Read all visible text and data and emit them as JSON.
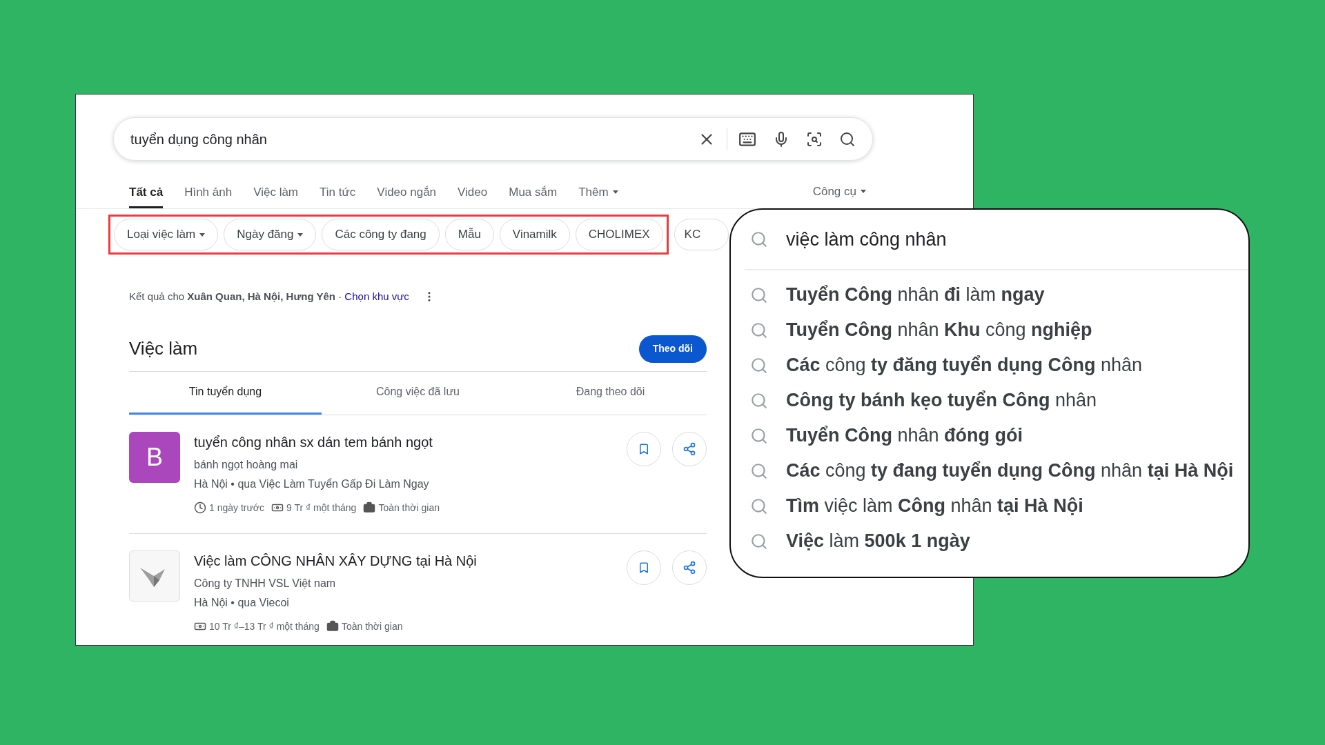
{
  "search": {
    "value": "tuyển dụng công nhân"
  },
  "tabs": [
    {
      "label": "Tất cả",
      "selected": true
    },
    {
      "label": "Hình ảnh",
      "selected": false
    },
    {
      "label": "Việc làm",
      "selected": false
    },
    {
      "label": "Tin tức",
      "selected": false
    },
    {
      "label": "Video ngắn",
      "selected": false
    },
    {
      "label": "Video",
      "selected": false
    },
    {
      "label": "Mua sắm",
      "selected": false
    },
    {
      "label": "Thêm",
      "selected": false,
      "dropdown": true
    }
  ],
  "tools": {
    "label": "Công cụ"
  },
  "highlighted_chips": [
    {
      "label": "Loại việc làm",
      "dropdown": true
    },
    {
      "label": "Ngày đăng",
      "dropdown": true
    },
    {
      "label": "Các công ty đang",
      "dropdown": false
    },
    {
      "label": "Mẫu",
      "dropdown": false
    },
    {
      "label": "Vinamilk",
      "dropdown": false
    },
    {
      "label": "CHOLIMEX",
      "dropdown": false
    }
  ],
  "chips": [
    {
      "label": "KC",
      "dropdown": false
    }
  ],
  "location": {
    "text": "Kết quả cho **Xuân Quan, Hà Nội, Hưng Yên** · ",
    "link": "Chọn khu vực"
  },
  "jobs": {
    "title": "Việc làm",
    "follow": "Theo dõi",
    "tabs": [
      {
        "label": "Tin tuyển dụng",
        "selected": true
      },
      {
        "label": "Công việc đã lưu",
        "selected": false
      },
      {
        "label": "Đang theo dõi",
        "selected": false
      }
    ],
    "items": [
      {
        "logo": {
          "kind": "letter",
          "text": "B",
          "color": "#ab47bc"
        },
        "title": "tuyển công nhân sx dán tem bánh ngọt",
        "company": "bánh ngọt hoàng mai",
        "source": "Hà Nội • qua Việc Làm Tuyển Gấp Đi Làm Ngay",
        "meta": [
          {
            "kind": "time",
            "text": "1 ngày trước"
          },
          {
            "kind": "salary",
            "text": "9 Tr ₫ một tháng"
          },
          {
            "kind": "type",
            "text": "Toàn thời gian"
          }
        ]
      },
      {
        "logo": {
          "kind": "image"
        },
        "title": "Việc làm CÔNG NHÂN XÂY DỰNG tại Hà Nội",
        "company": "Công ty TNHH VSL Việt nam",
        "source": "Hà Nội • qua Viecoi",
        "meta": [
          {
            "kind": "salary",
            "text": "10 Tr ₫–13 Tr ₫ một tháng"
          },
          {
            "kind": "type",
            "text": "Toàn thời gian"
          }
        ]
      }
    ]
  },
  "suggestions": {
    "query": "việc làm công nhân",
    "items": [
      "**Tuyển Công** nhân **đi** làm **ngay**",
      "**Tuyển Công** nhân **Khu** công **nghiệp**",
      "**Các** công **ty đăng tuyển dụng Công** nhân",
      "**Công ty bánh kẹo tuyển Công** nhân",
      "**Tuyển Công** nhân **đóng gói**",
      "**Các** công **ty đang tuyển dụng Công** nhân **tại Hà Nội**",
      "**Tìm** việc làm **Công** nhân **tại Hà Nội**",
      "**Việc** làm **500k 1 ngày**"
    ]
  }
}
